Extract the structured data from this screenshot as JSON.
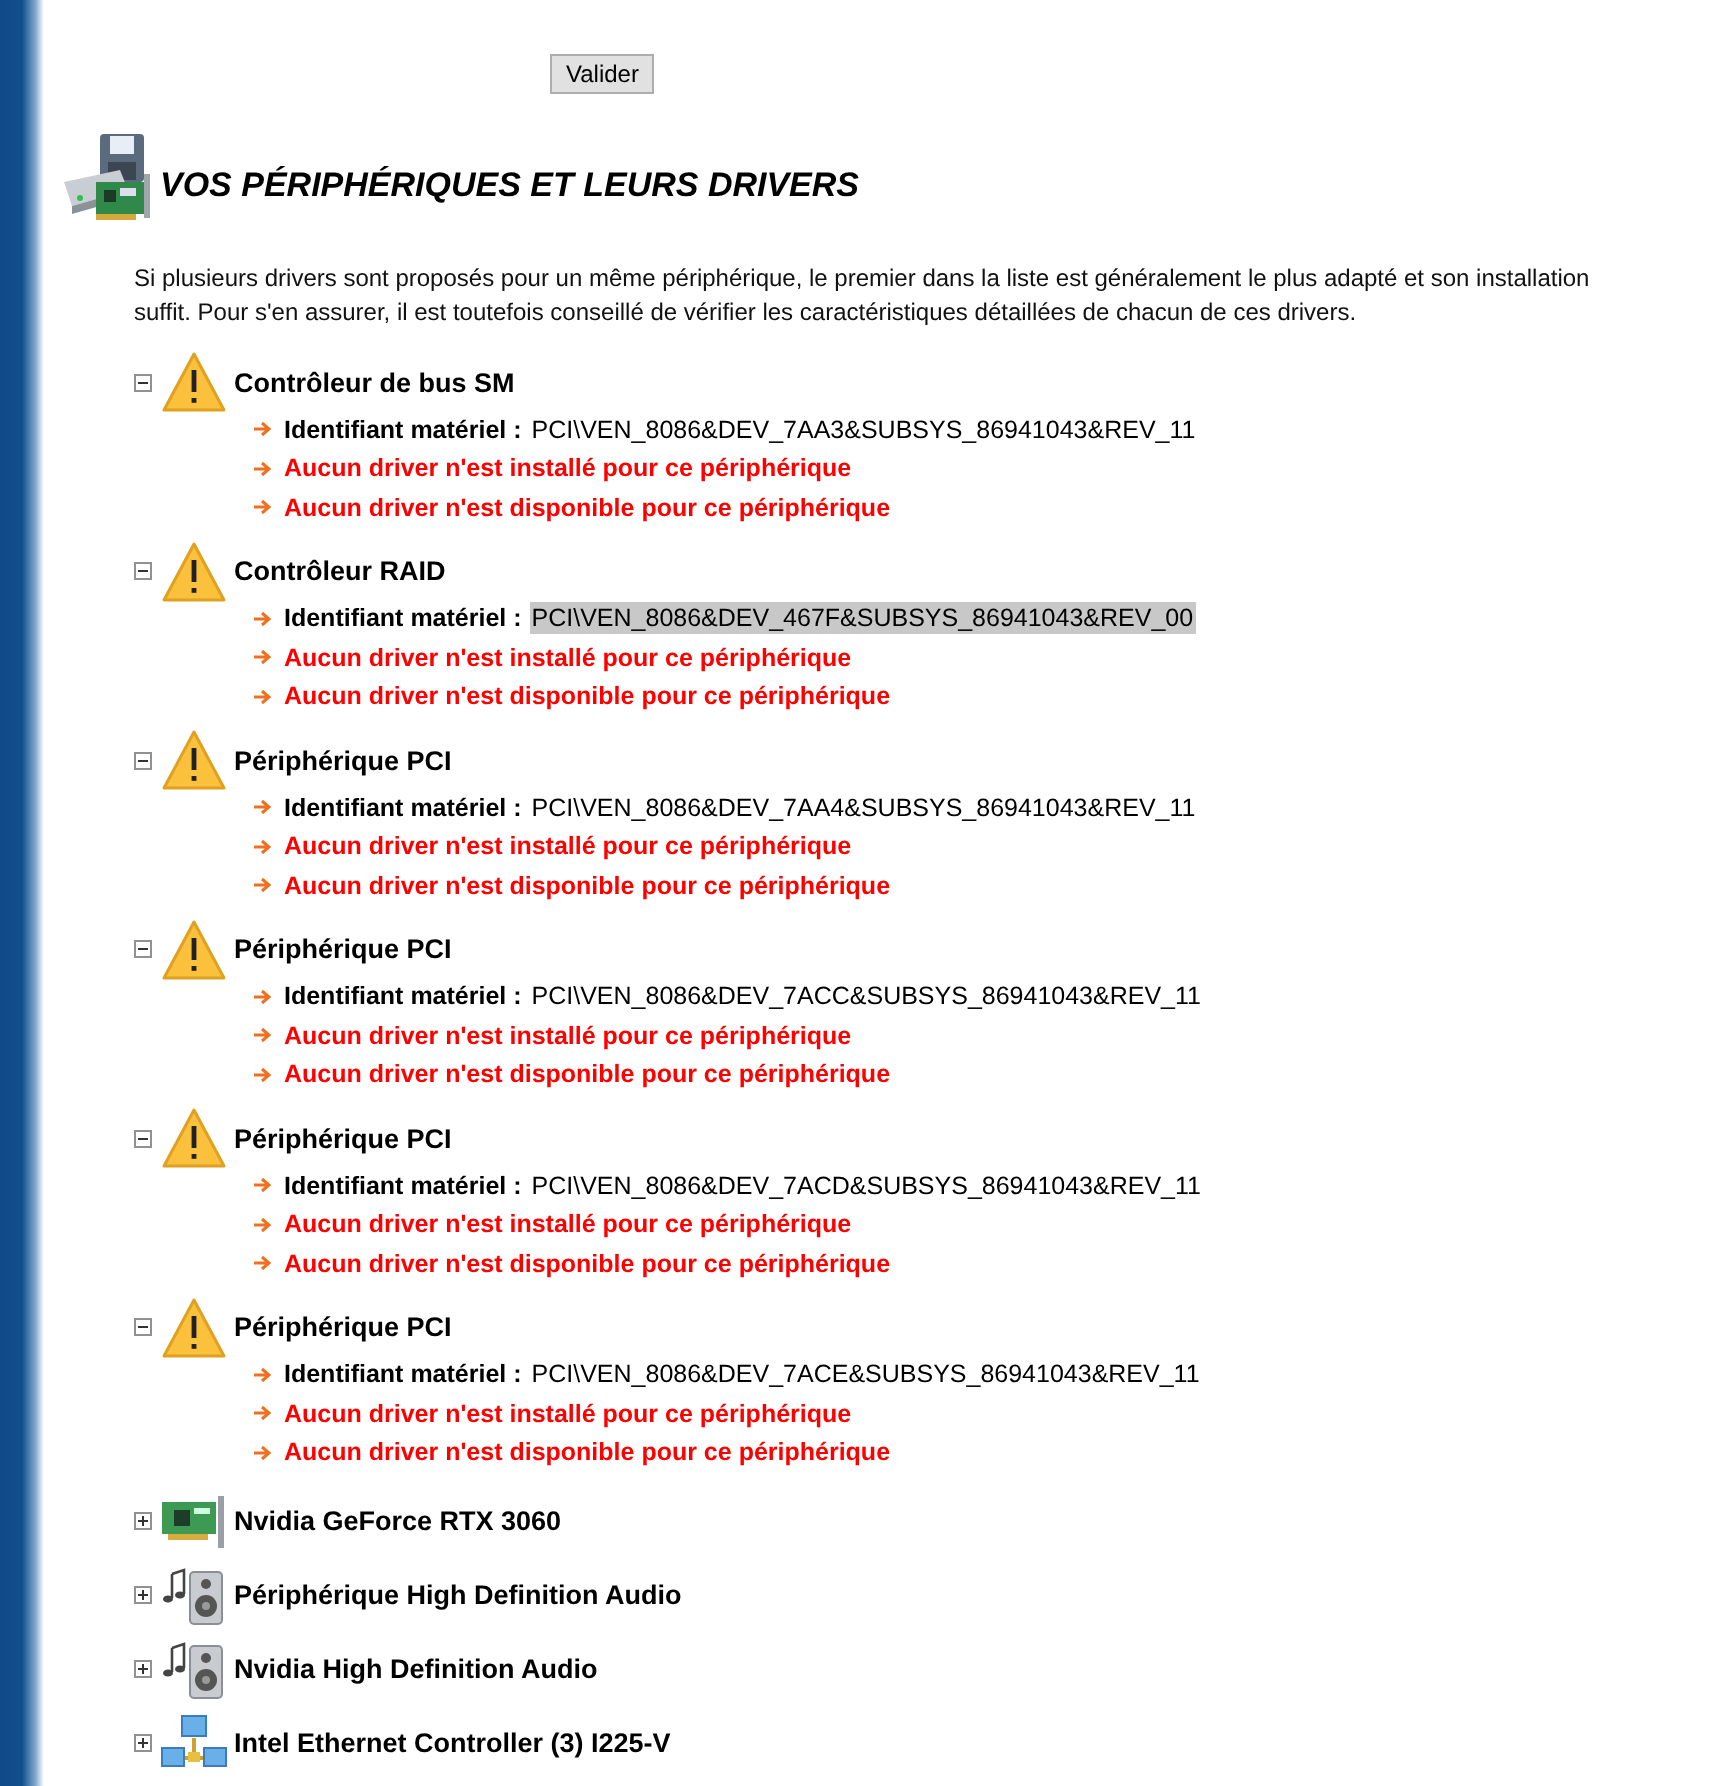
{
  "submit_button": "Valider",
  "heading": "VOS PÉRIPHÉRIQUES ET LEURS DRIVERS",
  "intro": "Si plusieurs drivers sont proposés pour un même périphérique, le premier dans la liste est généralement le plus adapté et son installation suffit. Pour s'en assurer, il est toutefois conseillé de vérifier les caractéristiques détaillées de chacun de ces drivers.",
  "devices": [
    {
      "name": "Contrôleur de bus SM",
      "kind": "warning",
      "expanded": true,
      "id_label": "Identifiant matériel :",
      "id_value": "PCI\\VEN_8086&DEV_7AA3&SUBSYS_86941043&REV_11",
      "id_selected": false,
      "messages": [
        "Aucun driver n'est installé pour ce périphérique",
        "Aucun driver n'est disponible pour ce périphérique"
      ]
    },
    {
      "name": "Contrôleur RAID",
      "kind": "warning",
      "expanded": true,
      "id_label": "Identifiant matériel :",
      "id_value": "PCI\\VEN_8086&DEV_467F&SUBSYS_86941043&REV_00",
      "id_selected": true,
      "messages": [
        "Aucun driver n'est installé pour ce périphérique",
        "Aucun driver n'est disponible pour ce périphérique"
      ]
    },
    {
      "name": "Périphérique PCI",
      "kind": "warning",
      "expanded": true,
      "id_label": "Identifiant matériel :",
      "id_value": "PCI\\VEN_8086&DEV_7AA4&SUBSYS_86941043&REV_11",
      "id_selected": false,
      "messages": [
        "Aucun driver n'est installé pour ce périphérique",
        "Aucun driver n'est disponible pour ce périphérique"
      ]
    },
    {
      "name": "Périphérique PCI",
      "kind": "warning",
      "expanded": true,
      "id_label": "Identifiant matériel :",
      "id_value": "PCI\\VEN_8086&DEV_7ACC&SUBSYS_86941043&REV_11",
      "id_selected": false,
      "messages": [
        "Aucun driver n'est installé pour ce périphérique",
        "Aucun driver n'est disponible pour ce périphérique"
      ]
    },
    {
      "name": "Périphérique PCI",
      "kind": "warning",
      "expanded": true,
      "id_label": "Identifiant matériel :",
      "id_value": "PCI\\VEN_8086&DEV_7ACD&SUBSYS_86941043&REV_11",
      "id_selected": false,
      "messages": [
        "Aucun driver n'est installé pour ce périphérique",
        "Aucun driver n'est disponible pour ce périphérique"
      ]
    },
    {
      "name": "Périphérique PCI",
      "kind": "warning",
      "expanded": true,
      "id_label": "Identifiant matériel :",
      "id_value": "PCI\\VEN_8086&DEV_7ACE&SUBSYS_86941043&REV_11",
      "id_selected": false,
      "messages": [
        "Aucun driver n'est installé pour ce périphérique",
        "Aucun driver n'est disponible pour ce périphérique"
      ]
    },
    {
      "name": "Nvidia GeForce RTX 3060",
      "kind": "card",
      "expanded": false
    },
    {
      "name": "Périphérique High Definition Audio",
      "kind": "audio",
      "expanded": false
    },
    {
      "name": "Nvidia High Definition Audio",
      "kind": "audio",
      "expanded": false
    },
    {
      "name": "Intel Ethernet Controller (3) I225-V",
      "kind": "network",
      "expanded": false
    }
  ]
}
